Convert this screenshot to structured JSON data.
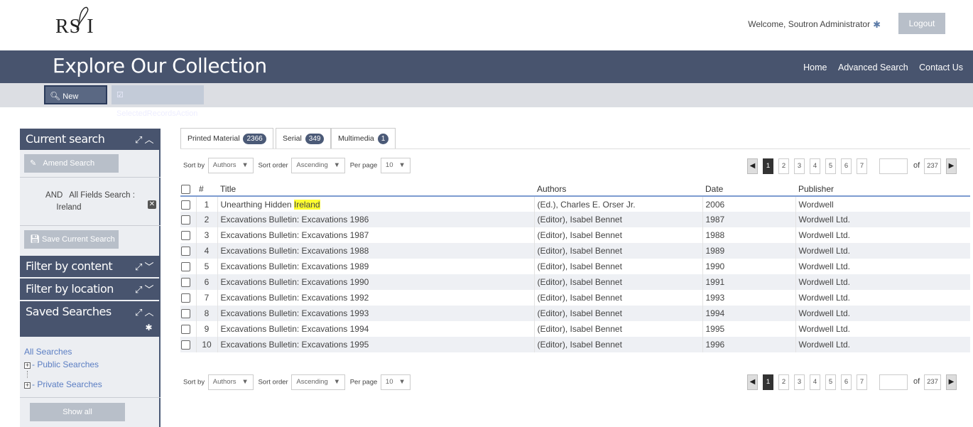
{
  "header": {
    "logo": "RS I",
    "welcome": "Welcome, Soutron Administrator",
    "logout_label": "Logout"
  },
  "banner": {
    "title": "Explore Our Collection",
    "nav": [
      "Home",
      "Advanced Search",
      "Contact Us"
    ]
  },
  "toolbar": {
    "new_search": "New Search",
    "selected_records": "SelectedRecordsAction (0)"
  },
  "sidebar": {
    "current_search": "Current search",
    "amend_search": "Amend Search",
    "criteria_op": "AND",
    "criteria_field": "All Fields Search :",
    "criteria_value": "Ireland",
    "save_current_search": "Save Current Search",
    "filter_content": "Filter by content",
    "filter_location": "Filter by location",
    "saved_searches": "Saved Searches",
    "all_searches": "All Searches",
    "public_searches": "Public Searches",
    "private_searches": "Private Searches",
    "show_all": "Show all"
  },
  "tabs": [
    {
      "label": "Printed Material",
      "count": "2366"
    },
    {
      "label": "Serial",
      "count": "349"
    },
    {
      "label": "Multimedia",
      "count": "1"
    }
  ],
  "controls": {
    "sort_by_label": "Sort by",
    "sort_by_value": "Authors",
    "sort_order_label": "Sort order",
    "sort_order_value": "Ascending",
    "per_page_label": "Per page",
    "per_page_value": "10"
  },
  "pager": {
    "pages": [
      "1",
      "2",
      "3",
      "4",
      "5",
      "6",
      "7"
    ],
    "current": "1",
    "of_label": "of",
    "total": "237"
  },
  "table": {
    "headers": {
      "num": "#",
      "title": "Title",
      "authors": "Authors",
      "date": "Date",
      "publisher": "Publisher"
    },
    "first_title_prefix": "Unearthing Hidden ",
    "first_title_highlight": "Ireland",
    "rows": [
      {
        "num": "1",
        "title": "Unearthing Hidden Ireland",
        "authors": "(Ed.), Charles E. Orser Jr.",
        "date": "2006",
        "publisher": "Wordwell"
      },
      {
        "num": "2",
        "title": "Excavations Bulletin: Excavations 1986",
        "authors": "(Editor), Isabel Bennet",
        "date": "1987",
        "publisher": "Wordwell Ltd."
      },
      {
        "num": "3",
        "title": "Excavations Bulletin: Excavations 1987",
        "authors": "(Editor), Isabel Bennet",
        "date": "1988",
        "publisher": "Wordwell Ltd."
      },
      {
        "num": "4",
        "title": "Excavations Bulletin: Excavations 1988",
        "authors": "(Editor), Isabel Bennet",
        "date": "1989",
        "publisher": "Wordwell Ltd."
      },
      {
        "num": "5",
        "title": "Excavations Bulletin: Excavations 1989",
        "authors": "(Editor), Isabel Bennet",
        "date": "1990",
        "publisher": "Wordwell Ltd."
      },
      {
        "num": "6",
        "title": "Excavations Bulletin: Excavations 1990",
        "authors": "(Editor), Isabel Bennet",
        "date": "1991",
        "publisher": "Wordwell Ltd."
      },
      {
        "num": "7",
        "title": "Excavations Bulletin: Excavations 1992",
        "authors": "(Editor), Isabel Bennet",
        "date": "1993",
        "publisher": "Wordwell Ltd."
      },
      {
        "num": "8",
        "title": "Excavations Bulletin: Excavations 1993",
        "authors": "(Editor), Isabel Bennet",
        "date": "1994",
        "publisher": "Wordwell Ltd."
      },
      {
        "num": "9",
        "title": "Excavations Bulletin: Excavations 1994",
        "authors": "(Editor), Isabel Bennet",
        "date": "1995",
        "publisher": "Wordwell Ltd."
      },
      {
        "num": "10",
        "title": "Excavations Bulletin: Excavations 1995",
        "authors": "(Editor), Isabel Bennet",
        "date": "1996",
        "publisher": "Wordwell Ltd."
      }
    ]
  },
  "colors": {
    "banner": "#48546e",
    "highlight": "#ffff30",
    "link": "#5b7ec3"
  }
}
